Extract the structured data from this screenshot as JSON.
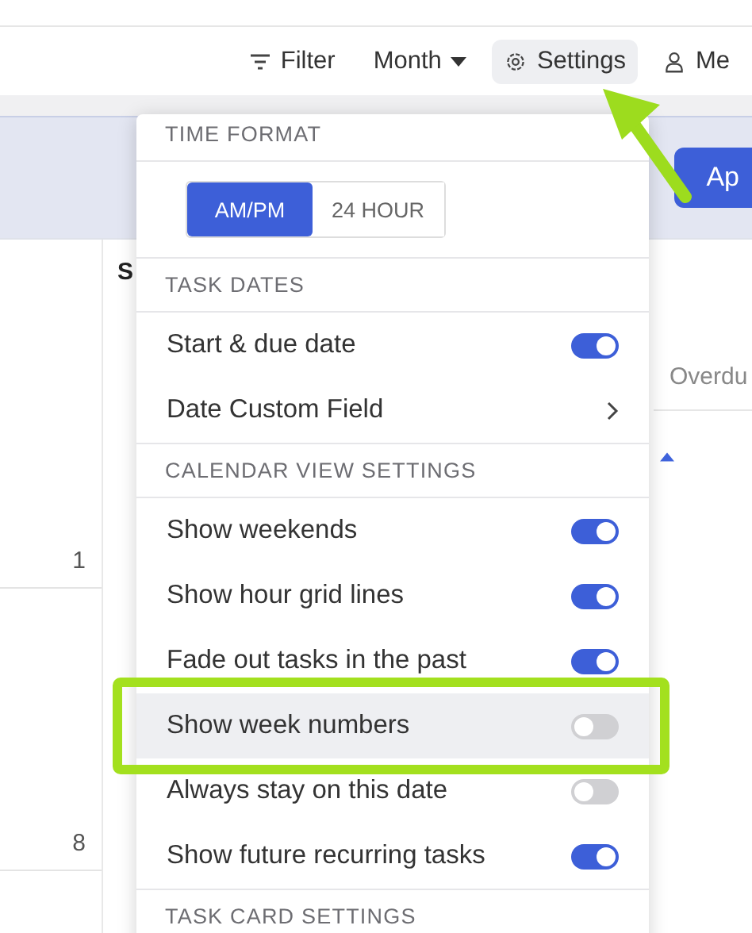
{
  "toolbar": [
    {
      "label": "Filter",
      "kind": "filter",
      "selected": false
    },
    {
      "label": "Month",
      "kind": "dropdown",
      "selected": false
    },
    {
      "label": "Settings",
      "kind": "settings",
      "selected": true
    },
    {
      "label": "Me",
      "kind": "person",
      "selected": false
    }
  ],
  "banner_button": "Ap",
  "calendar": {
    "column_header": "S",
    "day_numbers": [
      "1",
      "8"
    ],
    "side_label": "Overdu"
  },
  "settings_menu": {
    "sections": [
      {
        "title": "TIME FORMAT",
        "options": [
          {
            "label": "AM/PM",
            "selected": true
          },
          {
            "label": "24 HOUR",
            "selected": false
          }
        ]
      },
      {
        "title": "TASK DATES",
        "items": [
          {
            "label": "Start & due date",
            "kind": "toggle",
            "on": true,
            "highlighted": false
          },
          {
            "label": "Date Custom Field",
            "kind": "submenu",
            "highlighted": false
          }
        ]
      },
      {
        "title": "CALENDAR VIEW SETTINGS",
        "items": [
          {
            "label": "Show weekends",
            "kind": "toggle",
            "on": true,
            "highlighted": false
          },
          {
            "label": "Show hour grid lines",
            "kind": "toggle",
            "on": true,
            "highlighted": false
          },
          {
            "label": "Fade out tasks in the past",
            "kind": "toggle",
            "on": true,
            "highlighted": false
          },
          {
            "label": "Show week numbers",
            "kind": "toggle",
            "on": false,
            "highlighted": true
          },
          {
            "label": "Always stay on this date",
            "kind": "toggle",
            "on": false,
            "highlighted": false
          },
          {
            "label": "Show future recurring tasks",
            "kind": "toggle",
            "on": true,
            "highlighted": false
          }
        ]
      },
      {
        "title": "TASK CARD SETTINGS"
      }
    ]
  }
}
